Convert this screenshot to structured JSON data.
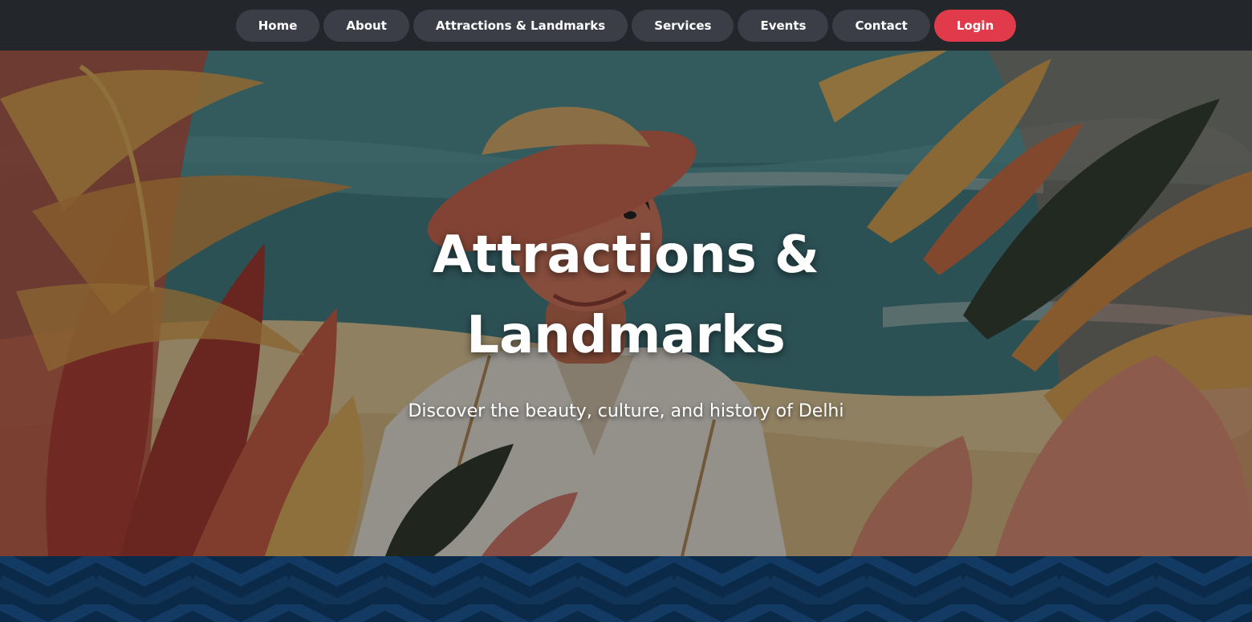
{
  "nav": {
    "items": [
      {
        "label": "Home"
      },
      {
        "label": "About"
      },
      {
        "label": "Attractions & Landmarks"
      },
      {
        "label": "Services"
      },
      {
        "label": "Events"
      },
      {
        "label": "Contact"
      }
    ],
    "login_label": "Login"
  },
  "hero": {
    "title": "Attractions & Landmarks",
    "subtitle": "Discover the beauty, culture, and history of Delhi",
    "image": "illustration-person-in-straw-hat-among-tropical-leaves"
  },
  "colors": {
    "nav_bg": "#23262b",
    "nav_pill": "#3b3e46",
    "login_accent": "#e03a4b",
    "band_bg": "#0b2a4a"
  }
}
